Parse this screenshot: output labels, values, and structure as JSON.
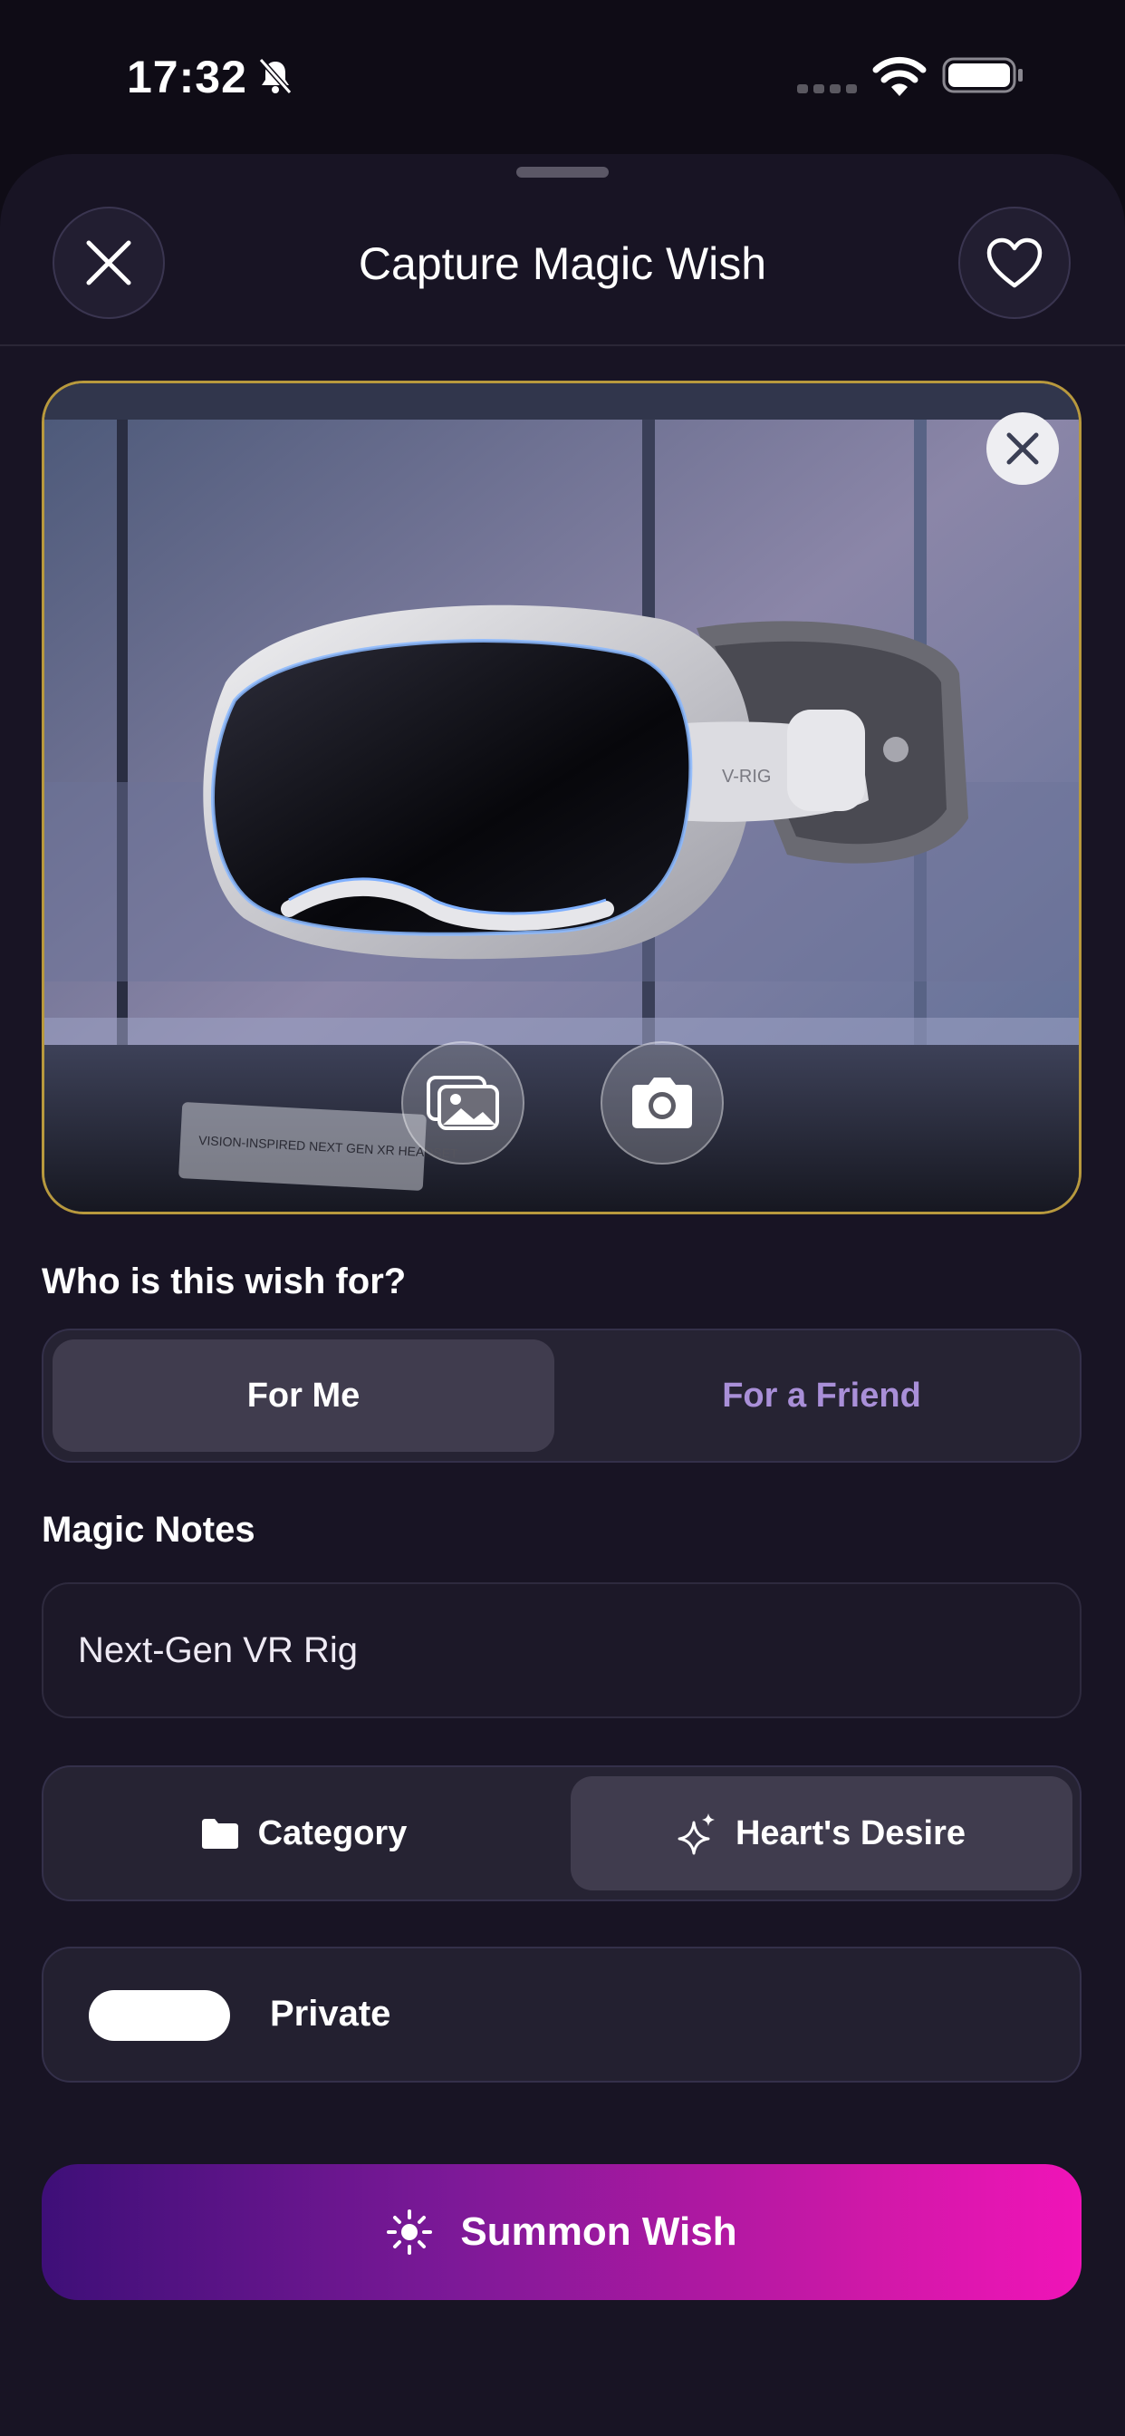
{
  "status_bar": {
    "time": "17:32",
    "icons": [
      "bell-slash-icon",
      "cellular-icon",
      "wifi-icon",
      "battery-icon"
    ]
  },
  "header": {
    "title": "Capture Magic Wish",
    "close_icon": "close-icon",
    "favorite_icon": "heart-icon"
  },
  "photo": {
    "remove_icon": "close-icon",
    "actions": [
      "photo-gallery-icon",
      "camera-icon"
    ],
    "product_brand": "V-RIG",
    "plaque_text": "VISION-INSPIRED NEXT GEN XR HEADSET"
  },
  "recipient": {
    "label": "Who is this wish for?",
    "options": [
      "For Me",
      "For a Friend"
    ],
    "selected": "For Me"
  },
  "notes": {
    "label": "Magic Notes",
    "value": "Next-Gen VR Rig"
  },
  "type_selector": {
    "options": [
      {
        "label": "Category",
        "icon": "folder-icon"
      },
      {
        "label": "Heart's Desire",
        "icon": "sparkles-icon"
      }
    ],
    "selected": "Heart's Desire"
  },
  "privacy": {
    "label": "Private",
    "enabled": false
  },
  "submit": {
    "label": "Summon Wish",
    "icon": "sun-icon"
  },
  "colors": {
    "accent_start": "#3e0f78",
    "accent_end": "#f014b8",
    "friend_text": "#a98fd8",
    "photo_border": "#b8993d"
  }
}
